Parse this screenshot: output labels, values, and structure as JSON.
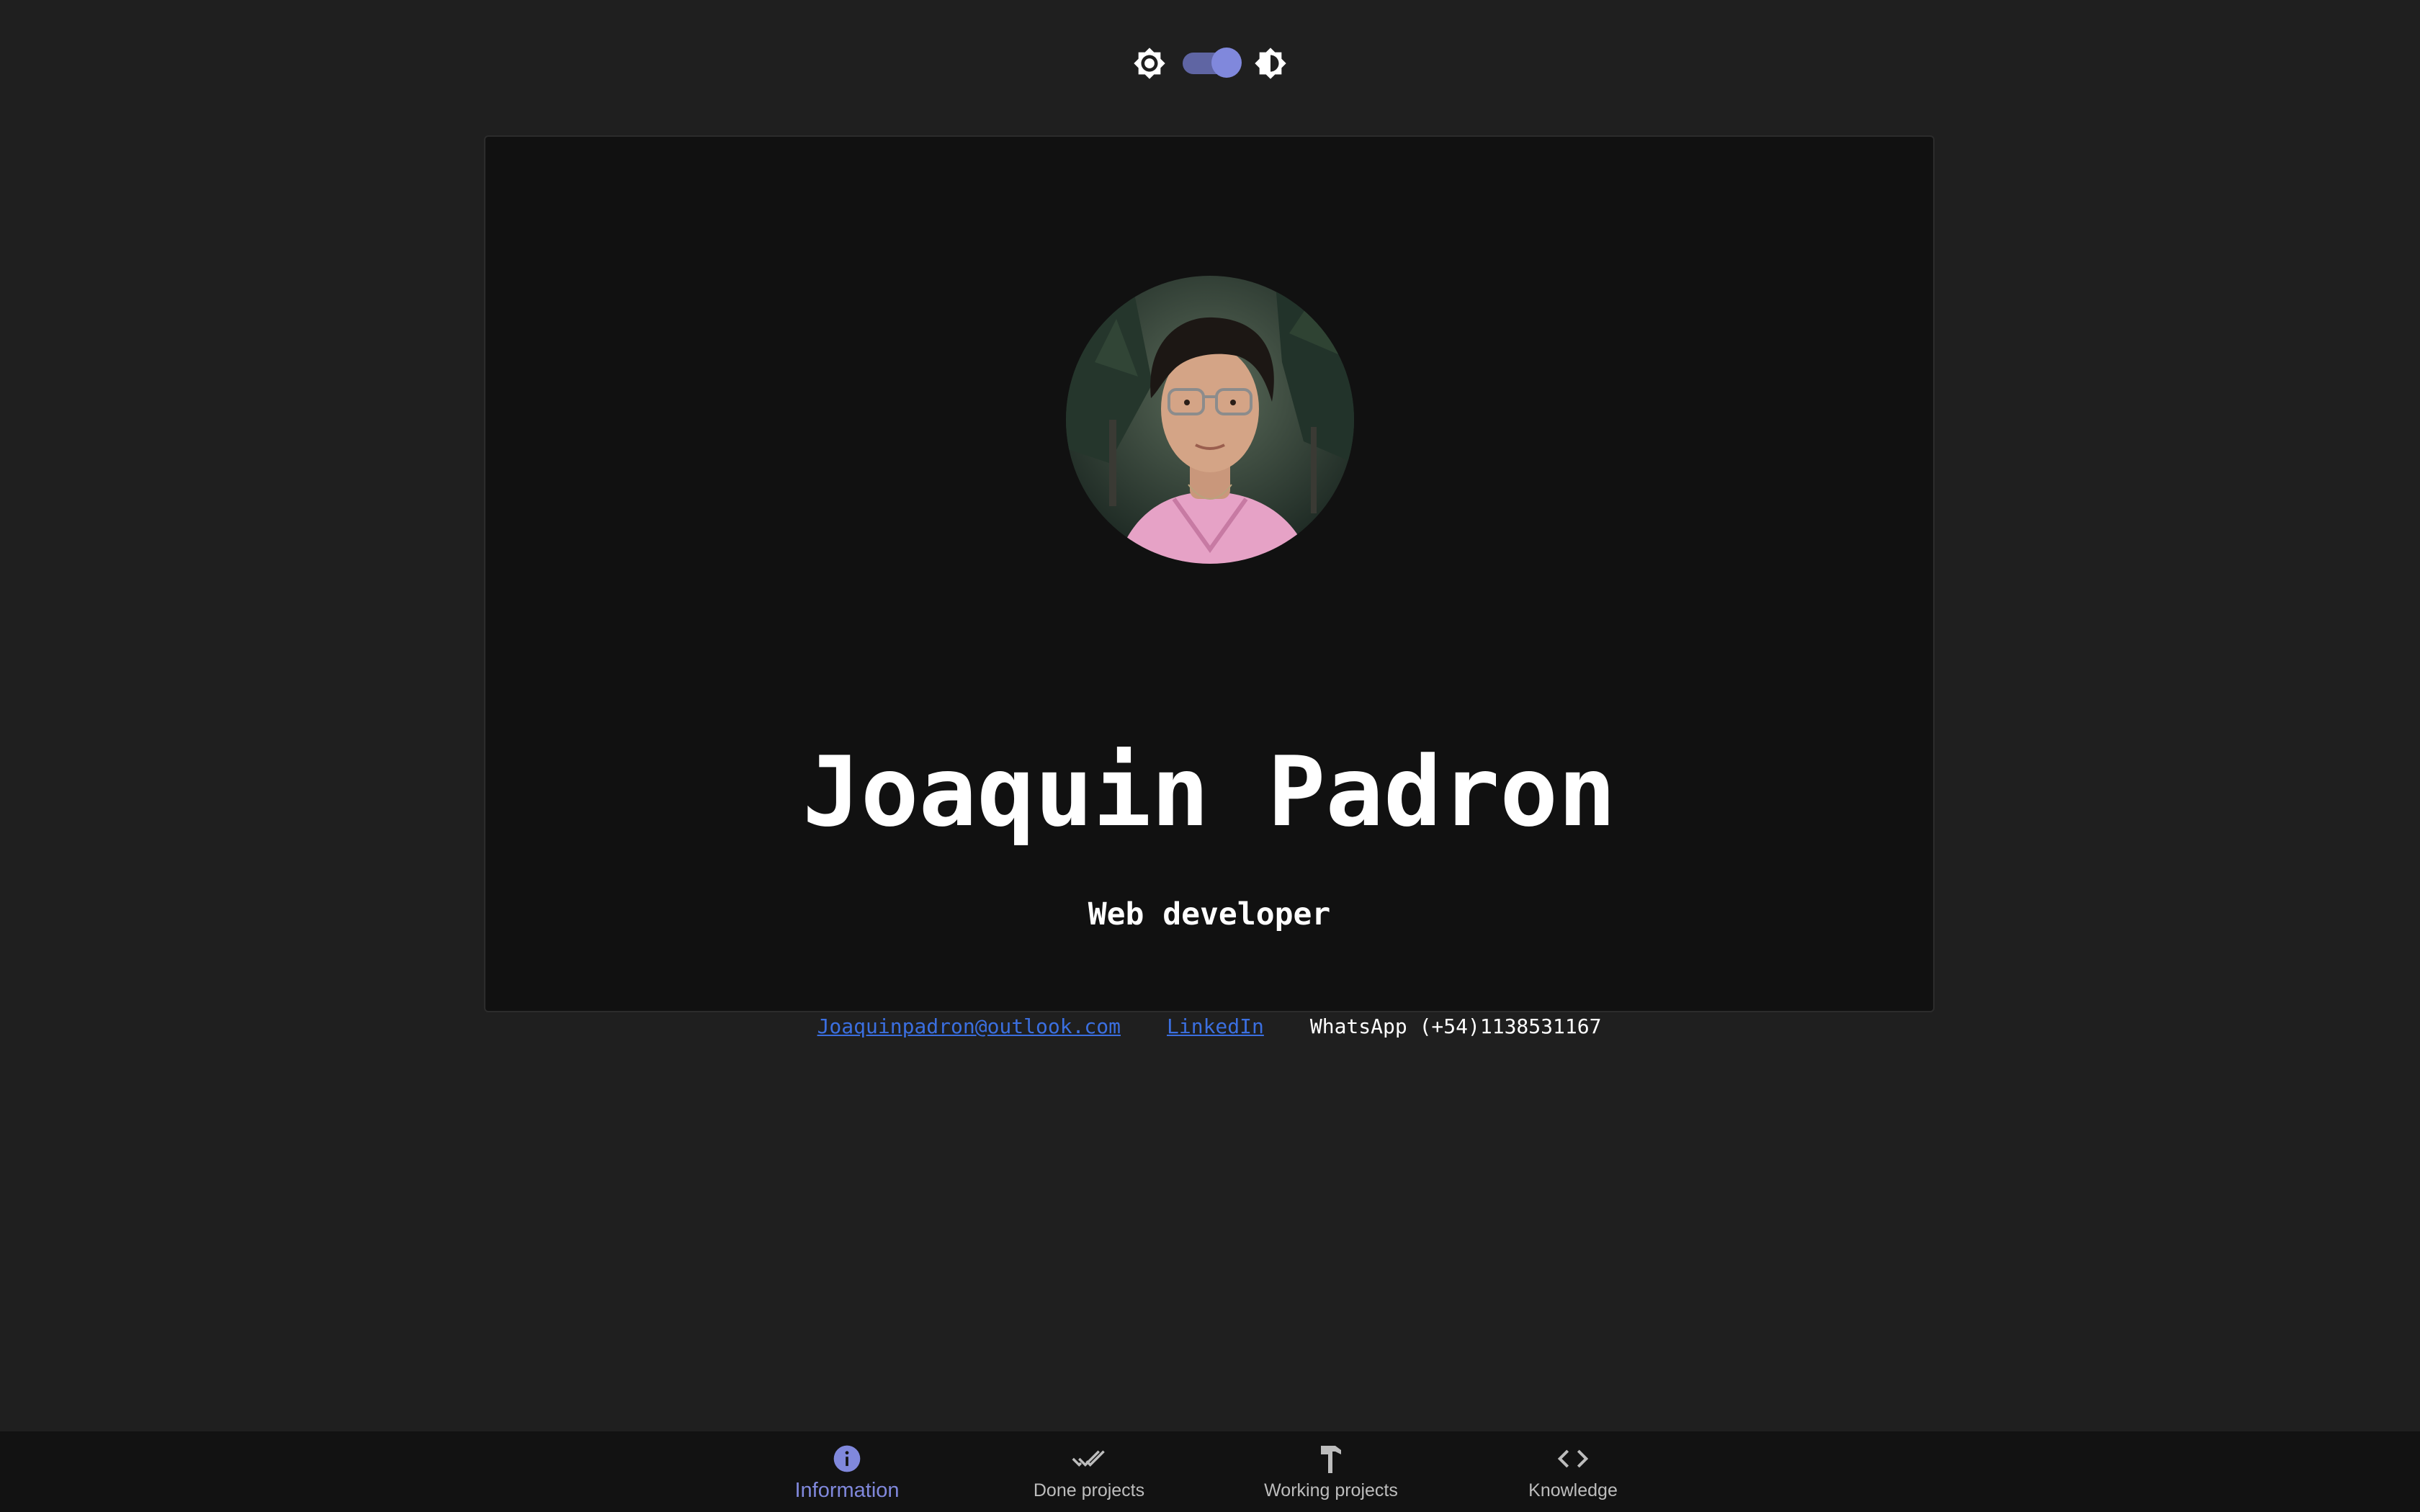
{
  "theme_toggle": {
    "light_icon": "sun-icon",
    "dark_icon": "half-sun-icon",
    "accent_color": "#8088dc",
    "state": "dark"
  },
  "profile": {
    "avatar_alt": "profile-photo",
    "name": "Joaquin Padron",
    "role": "Web developer",
    "email": "Joaquinpadron@outlook.com",
    "linkedin": "LinkedIn",
    "whatsapp": "WhatsApp (+54)1138531167"
  },
  "nav": {
    "items": [
      {
        "label": "Information",
        "icon": "info-icon",
        "active": true
      },
      {
        "label": "Done projects",
        "icon": "double-check-icon",
        "active": false
      },
      {
        "label": "Working projects",
        "icon": "hammer-icon",
        "active": false
      },
      {
        "label": "Knowledge",
        "icon": "code-icon",
        "active": false
      }
    ]
  },
  "colors": {
    "background": "#1f1f1f",
    "card": "#111111",
    "link": "#3b6fe0",
    "active_nav": "#8088dc",
    "inactive_nav": "#bdbdbd"
  }
}
